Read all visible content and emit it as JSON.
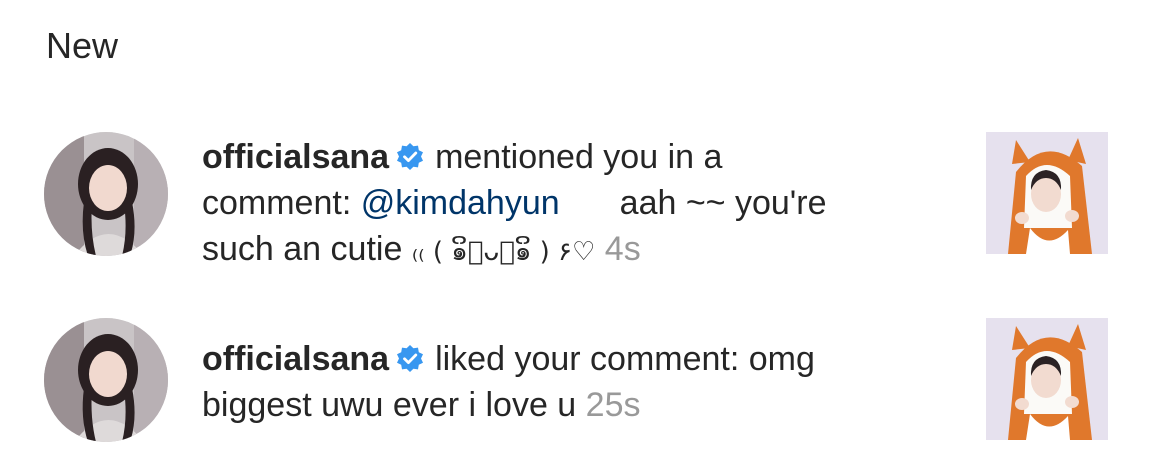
{
  "section_title": "New",
  "colors": {
    "text": "#262626",
    "mention": "#003569",
    "timestamp": "#999999",
    "verified_badge": "#3897f0"
  },
  "notifications": [
    {
      "username": "officialsana",
      "verified": true,
      "action": "mentioned you in a",
      "line2_prefix": "comment:",
      "mention": "@kimdahyun",
      "after_mention": "aah ~~ you're",
      "line3_text": "such an cutie",
      "kaomoji": "₍₍ ( ๑ິ⃕ᴗ⃔๑ິ ) ۶♡",
      "timestamp": "4s"
    },
    {
      "username": "officialsana",
      "verified": true,
      "action": "liked your comment: omg",
      "line2_text": "biggest uwu ever i love u",
      "timestamp": "25s"
    }
  ]
}
